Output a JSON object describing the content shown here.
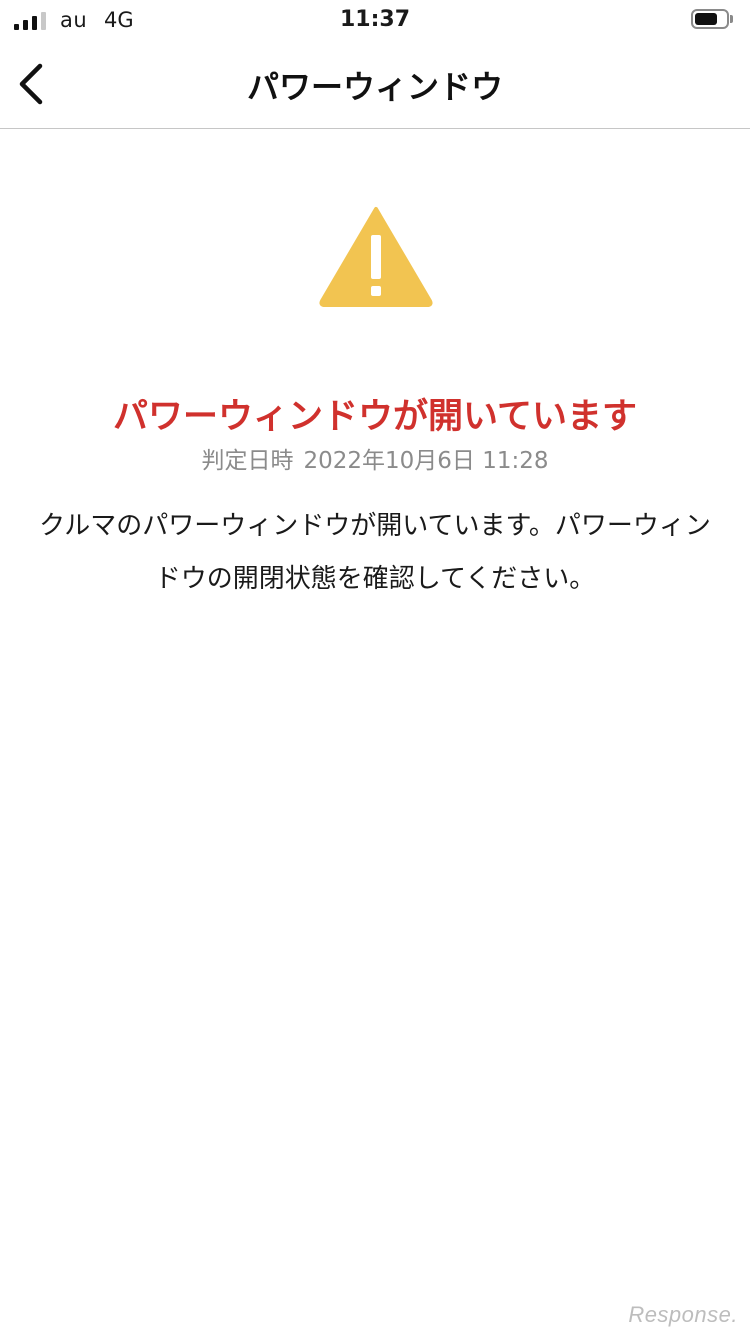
{
  "status_bar": {
    "carrier": "au",
    "network": "4G",
    "time": "11:37",
    "signal_bars_filled": 3,
    "signal_bars_total": 4
  },
  "nav": {
    "title": "パワーウィンドウ",
    "back_icon": "chevron-left-icon"
  },
  "alert": {
    "icon": "warning-icon",
    "icon_color": "#F2C451",
    "title": "パワーウィンドウが開いています",
    "title_color": "#D0312D",
    "timestamp_label": "判定日時",
    "timestamp_value": "2022年10月6日 11:28",
    "message": "クルマのパワーウィンドウが開いています。パワーウィンドウの開閉状態を確認してください。"
  },
  "watermark": "Response."
}
